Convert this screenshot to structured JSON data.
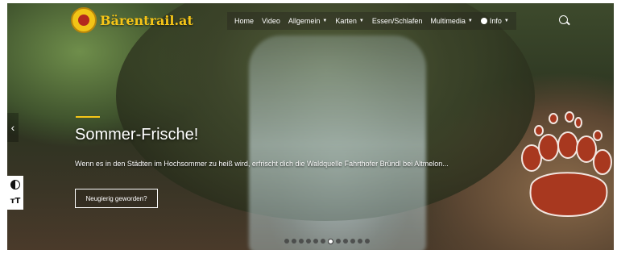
{
  "brand": {
    "name": "Bärentrail.at"
  },
  "nav": {
    "items": [
      {
        "label": "Home",
        "dropdown": false
      },
      {
        "label": "Video",
        "dropdown": false
      },
      {
        "label": "Allgemein",
        "dropdown": true
      },
      {
        "label": "Karten",
        "dropdown": true
      },
      {
        "label": "Essen/Schlafen",
        "dropdown": false
      },
      {
        "label": "Multimedia",
        "dropdown": true
      },
      {
        "label": "Info",
        "dropdown": true,
        "icon": "info-icon"
      }
    ],
    "search_icon": "search-icon"
  },
  "slide": {
    "title": "Sommer-Frische!",
    "text": "Wenn es in den Städten im Hochsommer zu heiß wird, erfrischt dich die Waldquelle Fahrthofer Bründl bei Altmelon...",
    "button": "Neugierig geworden?",
    "count": 12,
    "active_index": 6
  },
  "accessibility": {
    "contrast_icon": "contrast-icon",
    "font_label": "ᴛT"
  },
  "colors": {
    "accent": "#f5c518",
    "paw": "#a8381f",
    "logo_bg": "#f2c416"
  }
}
